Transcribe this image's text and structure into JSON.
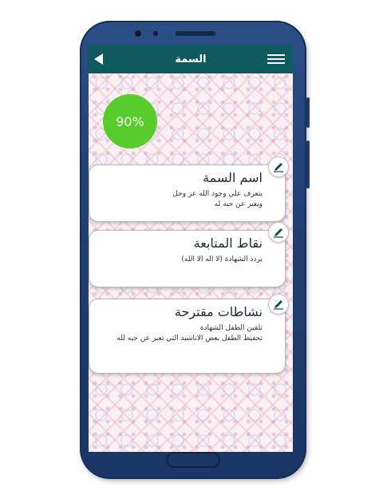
{
  "header": {
    "title": "السمة",
    "back_icon": "back-arrow-icon",
    "menu_icon": "hamburger-menu-icon",
    "color": "#0f5a5e"
  },
  "progress": {
    "label": "90%",
    "value": 0.9,
    "color": "#58cc2a"
  },
  "cards": [
    {
      "title": "اسم السمة",
      "body": "يتعرف علي وجود الله عز وجل\nويعبر عن حبه له",
      "icon": "pencil-edit-icon"
    },
    {
      "title": "نقاط المتابعة",
      "body": "يردد الشهادة (لا اله الا الله)",
      "icon": "pencil-edit-icon"
    },
    {
      "title": "نشاطات مقترحة",
      "body": "تلقين الطفل الشهادة\nتحفيظ الطفل بعض الاناشيد التي تعبر عن حبه لله",
      "icon": "pencil-edit-icon"
    }
  ]
}
